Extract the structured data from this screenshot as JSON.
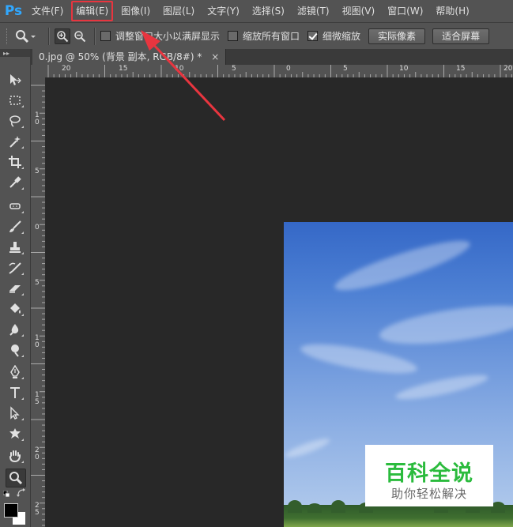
{
  "app": {
    "logo": "Ps"
  },
  "menu": [
    {
      "label": "文件(F)"
    },
    {
      "label": "编辑(E)",
      "highlighted": true
    },
    {
      "label": "图像(I)"
    },
    {
      "label": "图层(L)"
    },
    {
      "label": "文字(Y)"
    },
    {
      "label": "选择(S)"
    },
    {
      "label": "滤镜(T)"
    },
    {
      "label": "视图(V)"
    },
    {
      "label": "窗口(W)"
    },
    {
      "label": "帮助(H)"
    }
  ],
  "options": {
    "resize_windows_label": "调整窗口大小以满屏显示",
    "resize_windows_checked": false,
    "zoom_all_label": "缩放所有窗口",
    "zoom_all_checked": false,
    "scrubby_label": "细微缩放",
    "scrubby_checked": true,
    "actual_pixels_label": "实际像素",
    "fit_screen_label": "适合屏幕"
  },
  "document": {
    "tab_title": "0.jpg @ 50% (背景 副本, RGB/8#) *",
    "close_symbol": "×"
  },
  "ruler_h_labels": [
    "20",
    "15",
    "10",
    "5",
    "0",
    "5",
    "10",
    "15",
    "20"
  ],
  "ruler_v_labels": [
    "1\n0",
    "5",
    "0",
    "5",
    "1\n0",
    "1\n5",
    "2\n0",
    "2\n5"
  ],
  "tools": [
    "move-icon",
    "marquee-icon",
    "lasso-icon",
    "magic-wand-icon",
    "crop-icon",
    "eyedropper-icon",
    "healing-brush-icon",
    "brush-icon",
    "stamp-icon",
    "history-brush-icon",
    "eraser-icon",
    "paint-bucket-icon",
    "blur-icon",
    "dodge-icon",
    "pen-icon",
    "type-icon",
    "path-selection-icon",
    "shape-icon",
    "hand-icon",
    "zoom-icon"
  ],
  "colors": {
    "foreground": "#000000",
    "background": "#ffffff",
    "highlight": "#e8353f",
    "watermark_green": "#2bbb3d"
  },
  "watermark": {
    "title": "百科全说",
    "subtitle": "助你轻松解决"
  }
}
